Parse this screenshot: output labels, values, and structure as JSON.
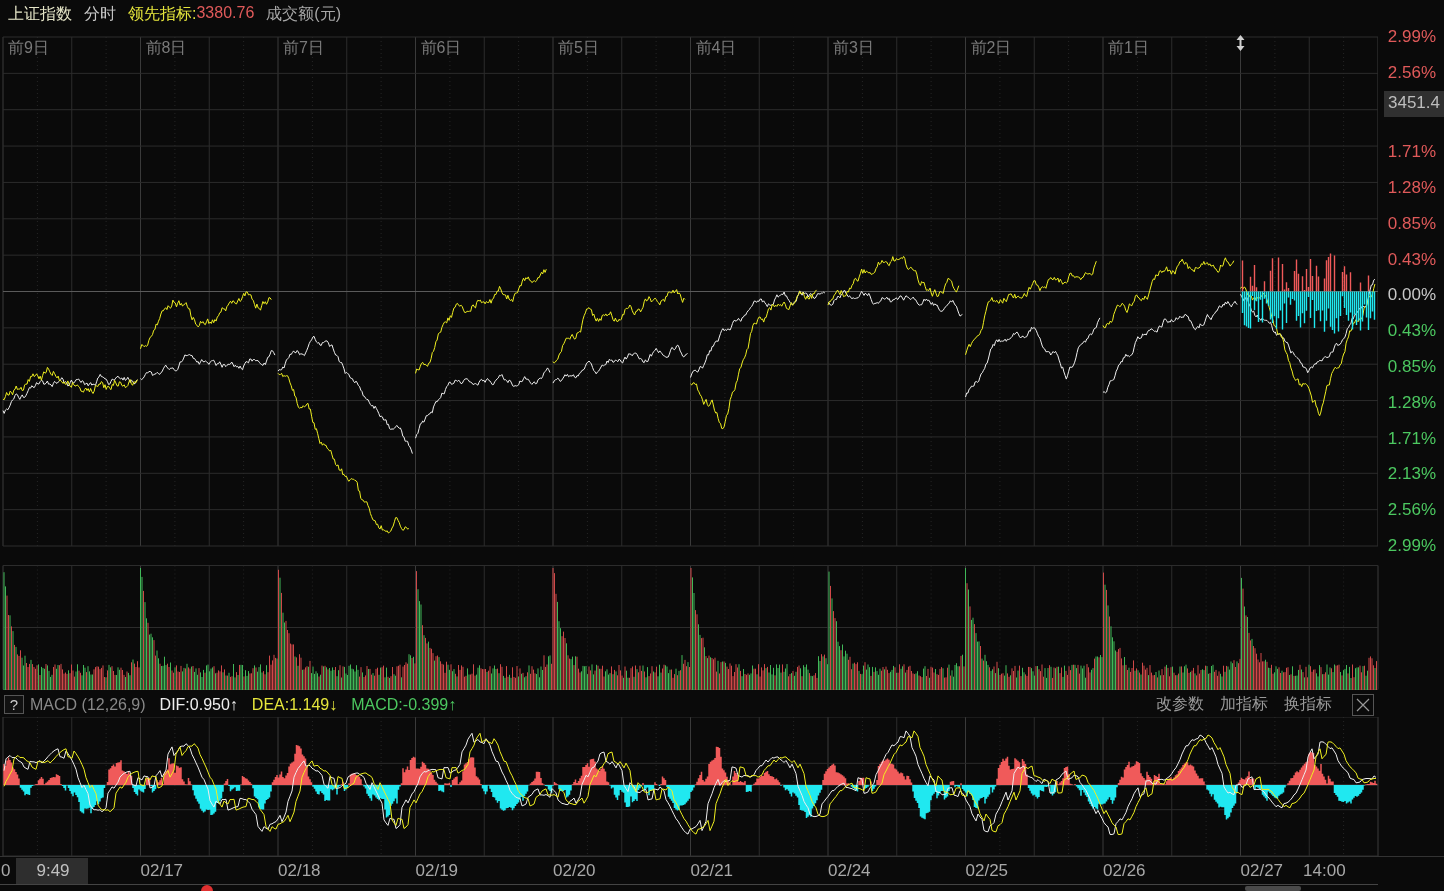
{
  "header": {
    "title": "上证指数",
    "mode": "分时",
    "indicator_label": "领先指标:",
    "indicator_value": "3380.76",
    "unit": "成交额(元)"
  },
  "day_labels": [
    "前9日",
    "前8日",
    "前7日",
    "前6日",
    "前5日",
    "前4日",
    "前3日",
    "前2日",
    "前1日"
  ],
  "axis_labels": [
    {
      "text": "2.99%",
      "kind": "up"
    },
    {
      "text": "2.56%",
      "kind": "up"
    },
    {
      "text": "3451.4",
      "kind": "price"
    },
    {
      "text": "1.71%",
      "kind": "up"
    },
    {
      "text": "1.28%",
      "kind": "up"
    },
    {
      "text": "0.85%",
      "kind": "up"
    },
    {
      "text": "0.43%",
      "kind": "up"
    },
    {
      "text": "0.00%",
      "kind": "zero"
    },
    {
      "text": "0.43%",
      "kind": "down"
    },
    {
      "text": "0.85%",
      "kind": "down"
    },
    {
      "text": "1.28%",
      "kind": "down"
    },
    {
      "text": "1.71%",
      "kind": "down"
    },
    {
      "text": "2.13%",
      "kind": "down"
    },
    {
      "text": "2.56%",
      "kind": "down"
    },
    {
      "text": "2.99%",
      "kind": "down"
    }
  ],
  "macd": {
    "help": "?",
    "name": "MACD (12,26,9)",
    "dif": "DIF:0.950↑",
    "dea": "DEA:1.149↓",
    "value": "MACD:-0.399↑",
    "actions": [
      "改参数",
      "加指标",
      "换指标"
    ]
  },
  "time_axis": {
    "start": "0",
    "cursor": "9:49",
    "dates": [
      "02/17",
      "02/18",
      "02/19",
      "02/20",
      "02/21",
      "02/24",
      "02/25",
      "02/26",
      "02/27"
    ],
    "end": "14:00"
  }
}
